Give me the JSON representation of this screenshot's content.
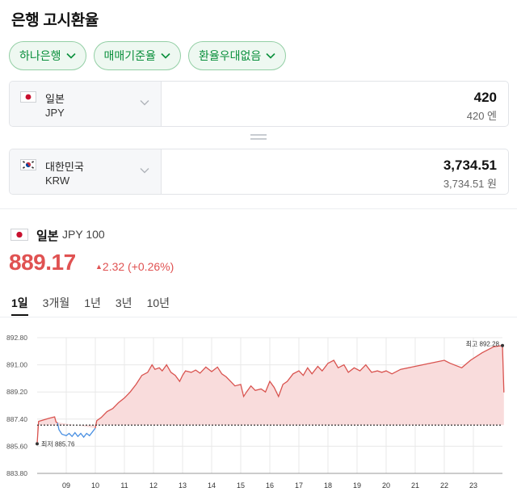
{
  "header": {
    "title": "은행 고시환율"
  },
  "filters": [
    {
      "label": "하나은행"
    },
    {
      "label": "매매기준율"
    },
    {
      "label": "환율우대없음"
    }
  ],
  "converter": {
    "from": {
      "name": "일본",
      "code": "JPY",
      "amount": "420",
      "amount_sub": "420 엔"
    },
    "to": {
      "name": "대한민국",
      "code": "KRW",
      "amount": "3,734.51",
      "amount_sub": "3,734.51 원"
    }
  },
  "quote": {
    "country": "일본",
    "unit": "JPY 100",
    "price": "889.17",
    "change": "2.32 (+0.26%)",
    "change_direction": "up"
  },
  "period_tabs": [
    {
      "label": "1일",
      "active": true
    },
    {
      "label": "3개월",
      "active": false
    },
    {
      "label": "1년",
      "active": false
    },
    {
      "label": "3년",
      "active": false
    },
    {
      "label": "10년",
      "active": false
    }
  ],
  "chart_data": {
    "type": "area",
    "x_ticks": [
      "09",
      "10",
      "11",
      "12",
      "13",
      "14",
      "15",
      "16",
      "17",
      "18",
      "19",
      "20",
      "21",
      "22",
      "23"
    ],
    "y_ticks": [
      "892.80",
      "891.00",
      "889.20",
      "887.40",
      "885.60",
      "883.80"
    ],
    "ylim": [
      883.8,
      892.8
    ],
    "baseline": 887.0,
    "max_label": "최고 892.28",
    "max_value": 892.28,
    "min_label": "최저 885.76",
    "min_value": 885.76,
    "series": [
      {
        "values": [
          [
            8.0,
            885.8
          ],
          [
            8.05,
            887.25
          ],
          [
            8.4,
            887.45
          ],
          [
            8.6,
            887.55
          ],
          [
            8.65,
            887.2
          ],
          [
            8.7,
            887.15
          ],
          [
            8.75,
            886.7
          ],
          [
            8.85,
            886.4
          ],
          [
            9.0,
            886.3
          ],
          [
            9.1,
            886.45
          ],
          [
            9.2,
            886.25
          ],
          [
            9.3,
            886.5
          ],
          [
            9.4,
            886.25
          ],
          [
            9.5,
            886.45
          ],
          [
            9.6,
            886.2
          ],
          [
            9.7,
            886.45
          ],
          [
            9.8,
            886.3
          ],
          [
            9.9,
            886.55
          ],
          [
            10.0,
            886.8
          ],
          [
            10.05,
            887.3
          ],
          [
            10.2,
            887.5
          ],
          [
            10.4,
            887.9
          ],
          [
            10.6,
            888.1
          ],
          [
            10.8,
            888.5
          ],
          [
            11.0,
            888.8
          ],
          [
            11.2,
            889.2
          ],
          [
            11.4,
            889.7
          ],
          [
            11.6,
            890.3
          ],
          [
            11.8,
            890.5
          ],
          [
            11.95,
            891.0
          ],
          [
            12.05,
            890.7
          ],
          [
            12.2,
            890.8
          ],
          [
            12.3,
            890.6
          ],
          [
            12.45,
            891.0
          ],
          [
            12.6,
            890.5
          ],
          [
            12.75,
            890.3
          ],
          [
            12.9,
            889.9
          ],
          [
            13.0,
            890.3
          ],
          [
            13.1,
            890.6
          ],
          [
            13.3,
            890.5
          ],
          [
            13.45,
            890.65
          ],
          [
            13.6,
            890.45
          ],
          [
            13.8,
            890.85
          ],
          [
            14.0,
            890.55
          ],
          [
            14.2,
            890.85
          ],
          [
            14.35,
            890.4
          ],
          [
            14.5,
            890.2
          ],
          [
            14.65,
            889.9
          ],
          [
            14.8,
            889.6
          ],
          [
            15.0,
            889.7
          ],
          [
            15.1,
            888.9
          ],
          [
            15.2,
            889.2
          ],
          [
            15.35,
            889.6
          ],
          [
            15.5,
            889.3
          ],
          [
            15.7,
            889.4
          ],
          [
            15.85,
            889.2
          ],
          [
            16.0,
            889.9
          ],
          [
            16.15,
            889.5
          ],
          [
            16.3,
            888.9
          ],
          [
            16.45,
            889.7
          ],
          [
            16.6,
            889.9
          ],
          [
            16.8,
            890.4
          ],
          [
            17.0,
            890.6
          ],
          [
            17.15,
            890.3
          ],
          [
            17.3,
            890.8
          ],
          [
            17.45,
            890.4
          ],
          [
            17.65,
            890.9
          ],
          [
            17.8,
            890.6
          ],
          [
            18.0,
            891.1
          ],
          [
            18.2,
            891.3
          ],
          [
            18.35,
            890.8
          ],
          [
            18.55,
            891.0
          ],
          [
            18.7,
            890.5
          ],
          [
            18.9,
            890.8
          ],
          [
            19.1,
            890.6
          ],
          [
            19.3,
            891.0
          ],
          [
            19.5,
            890.5
          ],
          [
            19.7,
            890.6
          ],
          [
            19.85,
            890.5
          ],
          [
            20.0,
            890.6
          ],
          [
            20.2,
            890.4
          ],
          [
            20.5,
            890.7
          ],
          [
            21.0,
            890.9
          ],
          [
            21.5,
            891.1
          ],
          [
            22.0,
            891.3
          ],
          [
            22.2,
            891.1
          ],
          [
            22.6,
            890.8
          ],
          [
            22.9,
            891.3
          ],
          [
            23.3,
            891.8
          ],
          [
            23.7,
            892.2
          ],
          [
            24.0,
            892.28
          ],
          [
            24.05,
            889.17
          ]
        ]
      }
    ],
    "colors": {
      "line": "#d9534f",
      "fill": "#f9dcdc",
      "pre_line": "#4a90e2",
      "baseline": "#333333",
      "grid": "#e8e8e8"
    }
  },
  "colors": {
    "accent_green": "#0a8f3c",
    "price_red": "#e05252"
  }
}
